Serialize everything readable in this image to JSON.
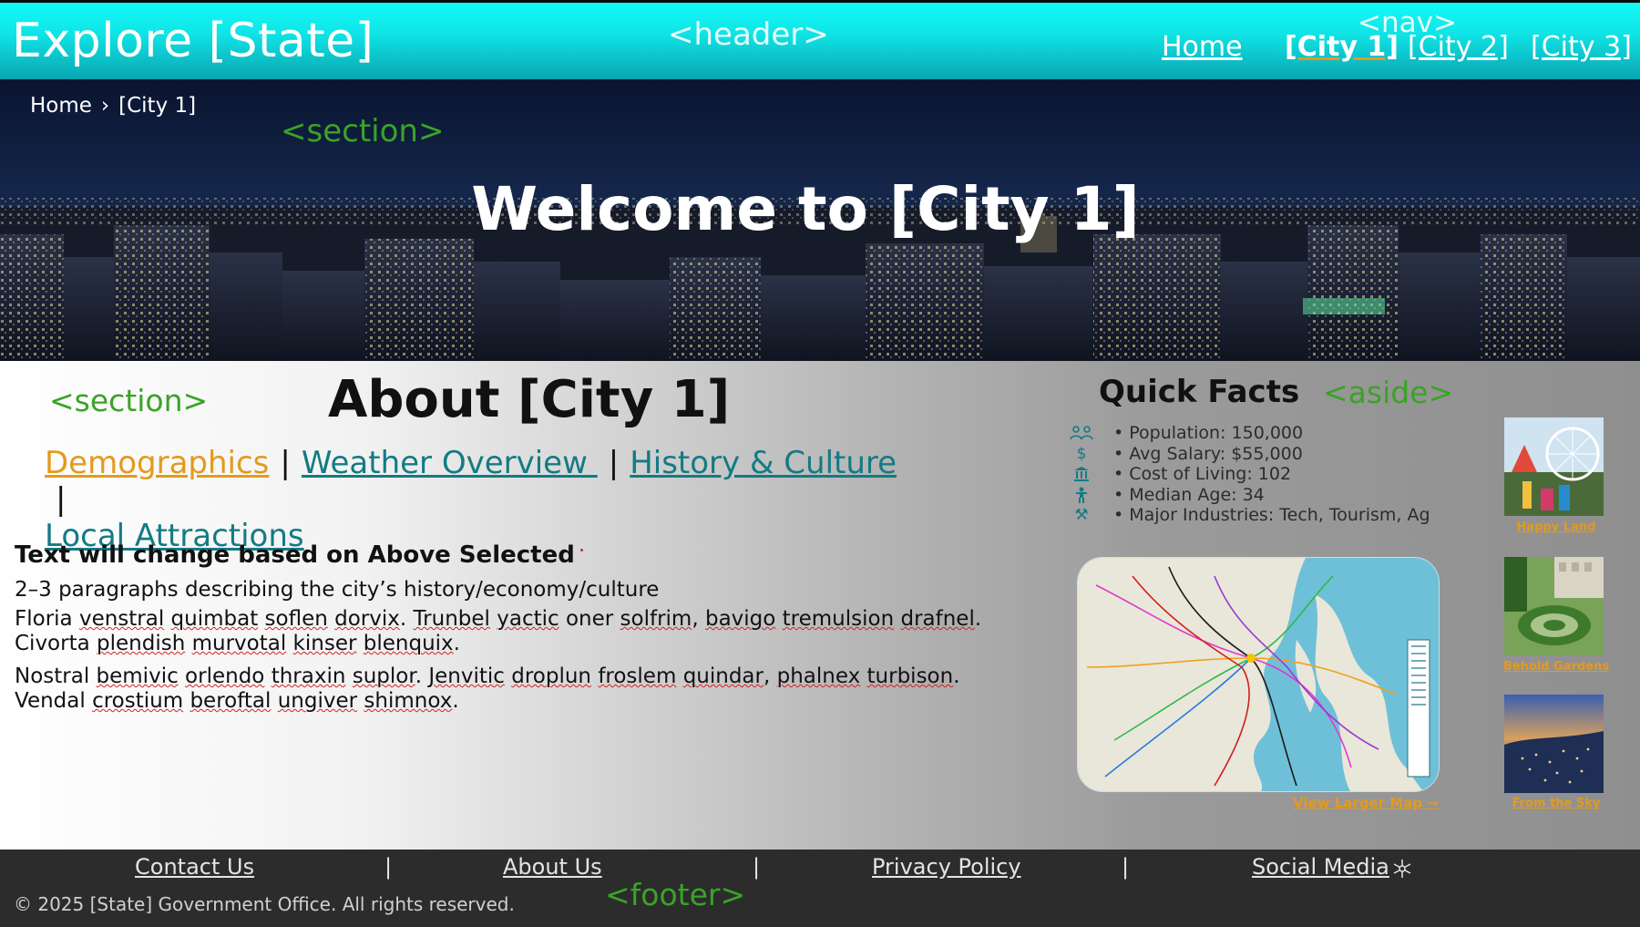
{
  "header": {
    "site_title": "Explore [State]",
    "tag_label": "<header>",
    "nav_tag_label": "<nav>",
    "nav": [
      {
        "label": "Home"
      },
      {
        "label": "[City 1]"
      },
      {
        "label": "[City 2]"
      },
      {
        "label": "[City 3]"
      }
    ]
  },
  "hero": {
    "breadcrumb": [
      "Home",
      "›",
      "[City 1]"
    ],
    "tag_label": "<section>",
    "title": "Welcome to [City 1]"
  },
  "about": {
    "tag_label": "<section>",
    "title": "About [City 1]",
    "topics": [
      {
        "label": "Demographics",
        "active": true
      },
      {
        "label": "Weather Overview "
      },
      {
        "label": "History & Culture "
      },
      {
        "label": "Local Attractions"
      }
    ],
    "separator": "|",
    "subheading": "Text will change based on Above Selected",
    "description": "2–3 paragraphs describing the city’s history/economy/culture",
    "paragraphs": [
      "Floria venstral quimbat soflen dorvix. Trunbel yactic oner solfrim, bavigo tremulsion drafnel. Civorta plendish murvotal kinser blenquix.",
      "Nostral bemivic orlendo thraxin suplor. Jenvitic droplun froslem quindar, phalnex turbison. Vendal crostium beroftal ungiver shimnox."
    ]
  },
  "aside": {
    "tag_label": "<aside>",
    "title": "Quick Facts",
    "facts": [
      {
        "icon": "people-icon",
        "text": "• Population: 150,000"
      },
      {
        "icon": "dollar-icon",
        "text": "• Avg Salary: $55,000"
      },
      {
        "icon": "bank-icon",
        "text": "• Cost of Living: 102"
      },
      {
        "icon": "person-icon",
        "text": "• Median Age: 34"
      },
      {
        "icon": "tools-icon",
        "text": "• Major Industries: Tech, Tourism, Ag"
      }
    ],
    "map_link": "View Larger Map →",
    "gallery": [
      {
        "caption": "Happy Land"
      },
      {
        "caption": "Behold Gardens"
      },
      {
        "caption": "From the Sky"
      }
    ]
  },
  "footer": {
    "links": [
      "Contact Us",
      "About Us",
      "Privacy Policy",
      "Social Media"
    ],
    "separator": "|",
    "copyright": "© 2025 [State] Government Office. All rights reserved.",
    "tag_label": "<footer>"
  },
  "colors": {
    "header_cyan": "#12fbf6",
    "accent_teal": "#137b84",
    "accent_orange": "#e39a1d",
    "tag_green": "#3aa327",
    "footer_bg": "#2c2c2c"
  }
}
